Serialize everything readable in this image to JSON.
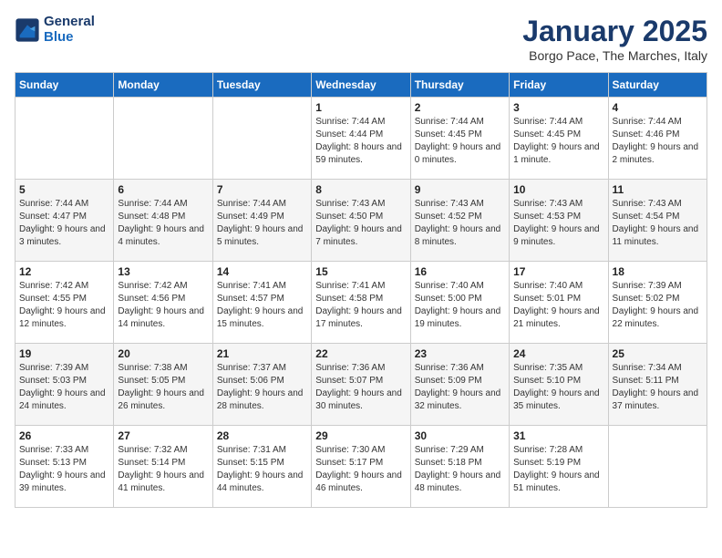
{
  "logo": {
    "line1": "General",
    "line2": "Blue"
  },
  "title": "January 2025",
  "subtitle": "Borgo Pace, The Marches, Italy",
  "weekdays": [
    "Sunday",
    "Monday",
    "Tuesday",
    "Wednesday",
    "Thursday",
    "Friday",
    "Saturday"
  ],
  "weeks": [
    [
      {
        "day": "",
        "sunrise": "",
        "sunset": "",
        "daylight": ""
      },
      {
        "day": "",
        "sunrise": "",
        "sunset": "",
        "daylight": ""
      },
      {
        "day": "",
        "sunrise": "",
        "sunset": "",
        "daylight": ""
      },
      {
        "day": "1",
        "sunrise": "Sunrise: 7:44 AM",
        "sunset": "Sunset: 4:44 PM",
        "daylight": "Daylight: 8 hours and 59 minutes."
      },
      {
        "day": "2",
        "sunrise": "Sunrise: 7:44 AM",
        "sunset": "Sunset: 4:45 PM",
        "daylight": "Daylight: 9 hours and 0 minutes."
      },
      {
        "day": "3",
        "sunrise": "Sunrise: 7:44 AM",
        "sunset": "Sunset: 4:45 PM",
        "daylight": "Daylight: 9 hours and 1 minute."
      },
      {
        "day": "4",
        "sunrise": "Sunrise: 7:44 AM",
        "sunset": "Sunset: 4:46 PM",
        "daylight": "Daylight: 9 hours and 2 minutes."
      }
    ],
    [
      {
        "day": "5",
        "sunrise": "Sunrise: 7:44 AM",
        "sunset": "Sunset: 4:47 PM",
        "daylight": "Daylight: 9 hours and 3 minutes."
      },
      {
        "day": "6",
        "sunrise": "Sunrise: 7:44 AM",
        "sunset": "Sunset: 4:48 PM",
        "daylight": "Daylight: 9 hours and 4 minutes."
      },
      {
        "day": "7",
        "sunrise": "Sunrise: 7:44 AM",
        "sunset": "Sunset: 4:49 PM",
        "daylight": "Daylight: 9 hours and 5 minutes."
      },
      {
        "day": "8",
        "sunrise": "Sunrise: 7:43 AM",
        "sunset": "Sunset: 4:50 PM",
        "daylight": "Daylight: 9 hours and 7 minutes."
      },
      {
        "day": "9",
        "sunrise": "Sunrise: 7:43 AM",
        "sunset": "Sunset: 4:52 PM",
        "daylight": "Daylight: 9 hours and 8 minutes."
      },
      {
        "day": "10",
        "sunrise": "Sunrise: 7:43 AM",
        "sunset": "Sunset: 4:53 PM",
        "daylight": "Daylight: 9 hours and 9 minutes."
      },
      {
        "day": "11",
        "sunrise": "Sunrise: 7:43 AM",
        "sunset": "Sunset: 4:54 PM",
        "daylight": "Daylight: 9 hours and 11 minutes."
      }
    ],
    [
      {
        "day": "12",
        "sunrise": "Sunrise: 7:42 AM",
        "sunset": "Sunset: 4:55 PM",
        "daylight": "Daylight: 9 hours and 12 minutes."
      },
      {
        "day": "13",
        "sunrise": "Sunrise: 7:42 AM",
        "sunset": "Sunset: 4:56 PM",
        "daylight": "Daylight: 9 hours and 14 minutes."
      },
      {
        "day": "14",
        "sunrise": "Sunrise: 7:41 AM",
        "sunset": "Sunset: 4:57 PM",
        "daylight": "Daylight: 9 hours and 15 minutes."
      },
      {
        "day": "15",
        "sunrise": "Sunrise: 7:41 AM",
        "sunset": "Sunset: 4:58 PM",
        "daylight": "Daylight: 9 hours and 17 minutes."
      },
      {
        "day": "16",
        "sunrise": "Sunrise: 7:40 AM",
        "sunset": "Sunset: 5:00 PM",
        "daylight": "Daylight: 9 hours and 19 minutes."
      },
      {
        "day": "17",
        "sunrise": "Sunrise: 7:40 AM",
        "sunset": "Sunset: 5:01 PM",
        "daylight": "Daylight: 9 hours and 21 minutes."
      },
      {
        "day": "18",
        "sunrise": "Sunrise: 7:39 AM",
        "sunset": "Sunset: 5:02 PM",
        "daylight": "Daylight: 9 hours and 22 minutes."
      }
    ],
    [
      {
        "day": "19",
        "sunrise": "Sunrise: 7:39 AM",
        "sunset": "Sunset: 5:03 PM",
        "daylight": "Daylight: 9 hours and 24 minutes."
      },
      {
        "day": "20",
        "sunrise": "Sunrise: 7:38 AM",
        "sunset": "Sunset: 5:05 PM",
        "daylight": "Daylight: 9 hours and 26 minutes."
      },
      {
        "day": "21",
        "sunrise": "Sunrise: 7:37 AM",
        "sunset": "Sunset: 5:06 PM",
        "daylight": "Daylight: 9 hours and 28 minutes."
      },
      {
        "day": "22",
        "sunrise": "Sunrise: 7:36 AM",
        "sunset": "Sunset: 5:07 PM",
        "daylight": "Daylight: 9 hours and 30 minutes."
      },
      {
        "day": "23",
        "sunrise": "Sunrise: 7:36 AM",
        "sunset": "Sunset: 5:09 PM",
        "daylight": "Daylight: 9 hours and 32 minutes."
      },
      {
        "day": "24",
        "sunrise": "Sunrise: 7:35 AM",
        "sunset": "Sunset: 5:10 PM",
        "daylight": "Daylight: 9 hours and 35 minutes."
      },
      {
        "day": "25",
        "sunrise": "Sunrise: 7:34 AM",
        "sunset": "Sunset: 5:11 PM",
        "daylight": "Daylight: 9 hours and 37 minutes."
      }
    ],
    [
      {
        "day": "26",
        "sunrise": "Sunrise: 7:33 AM",
        "sunset": "Sunset: 5:13 PM",
        "daylight": "Daylight: 9 hours and 39 minutes."
      },
      {
        "day": "27",
        "sunrise": "Sunrise: 7:32 AM",
        "sunset": "Sunset: 5:14 PM",
        "daylight": "Daylight: 9 hours and 41 minutes."
      },
      {
        "day": "28",
        "sunrise": "Sunrise: 7:31 AM",
        "sunset": "Sunset: 5:15 PM",
        "daylight": "Daylight: 9 hours and 44 minutes."
      },
      {
        "day": "29",
        "sunrise": "Sunrise: 7:30 AM",
        "sunset": "Sunset: 5:17 PM",
        "daylight": "Daylight: 9 hours and 46 minutes."
      },
      {
        "day": "30",
        "sunrise": "Sunrise: 7:29 AM",
        "sunset": "Sunset: 5:18 PM",
        "daylight": "Daylight: 9 hours and 48 minutes."
      },
      {
        "day": "31",
        "sunrise": "Sunrise: 7:28 AM",
        "sunset": "Sunset: 5:19 PM",
        "daylight": "Daylight: 9 hours and 51 minutes."
      },
      {
        "day": "",
        "sunrise": "",
        "sunset": "",
        "daylight": ""
      }
    ]
  ]
}
